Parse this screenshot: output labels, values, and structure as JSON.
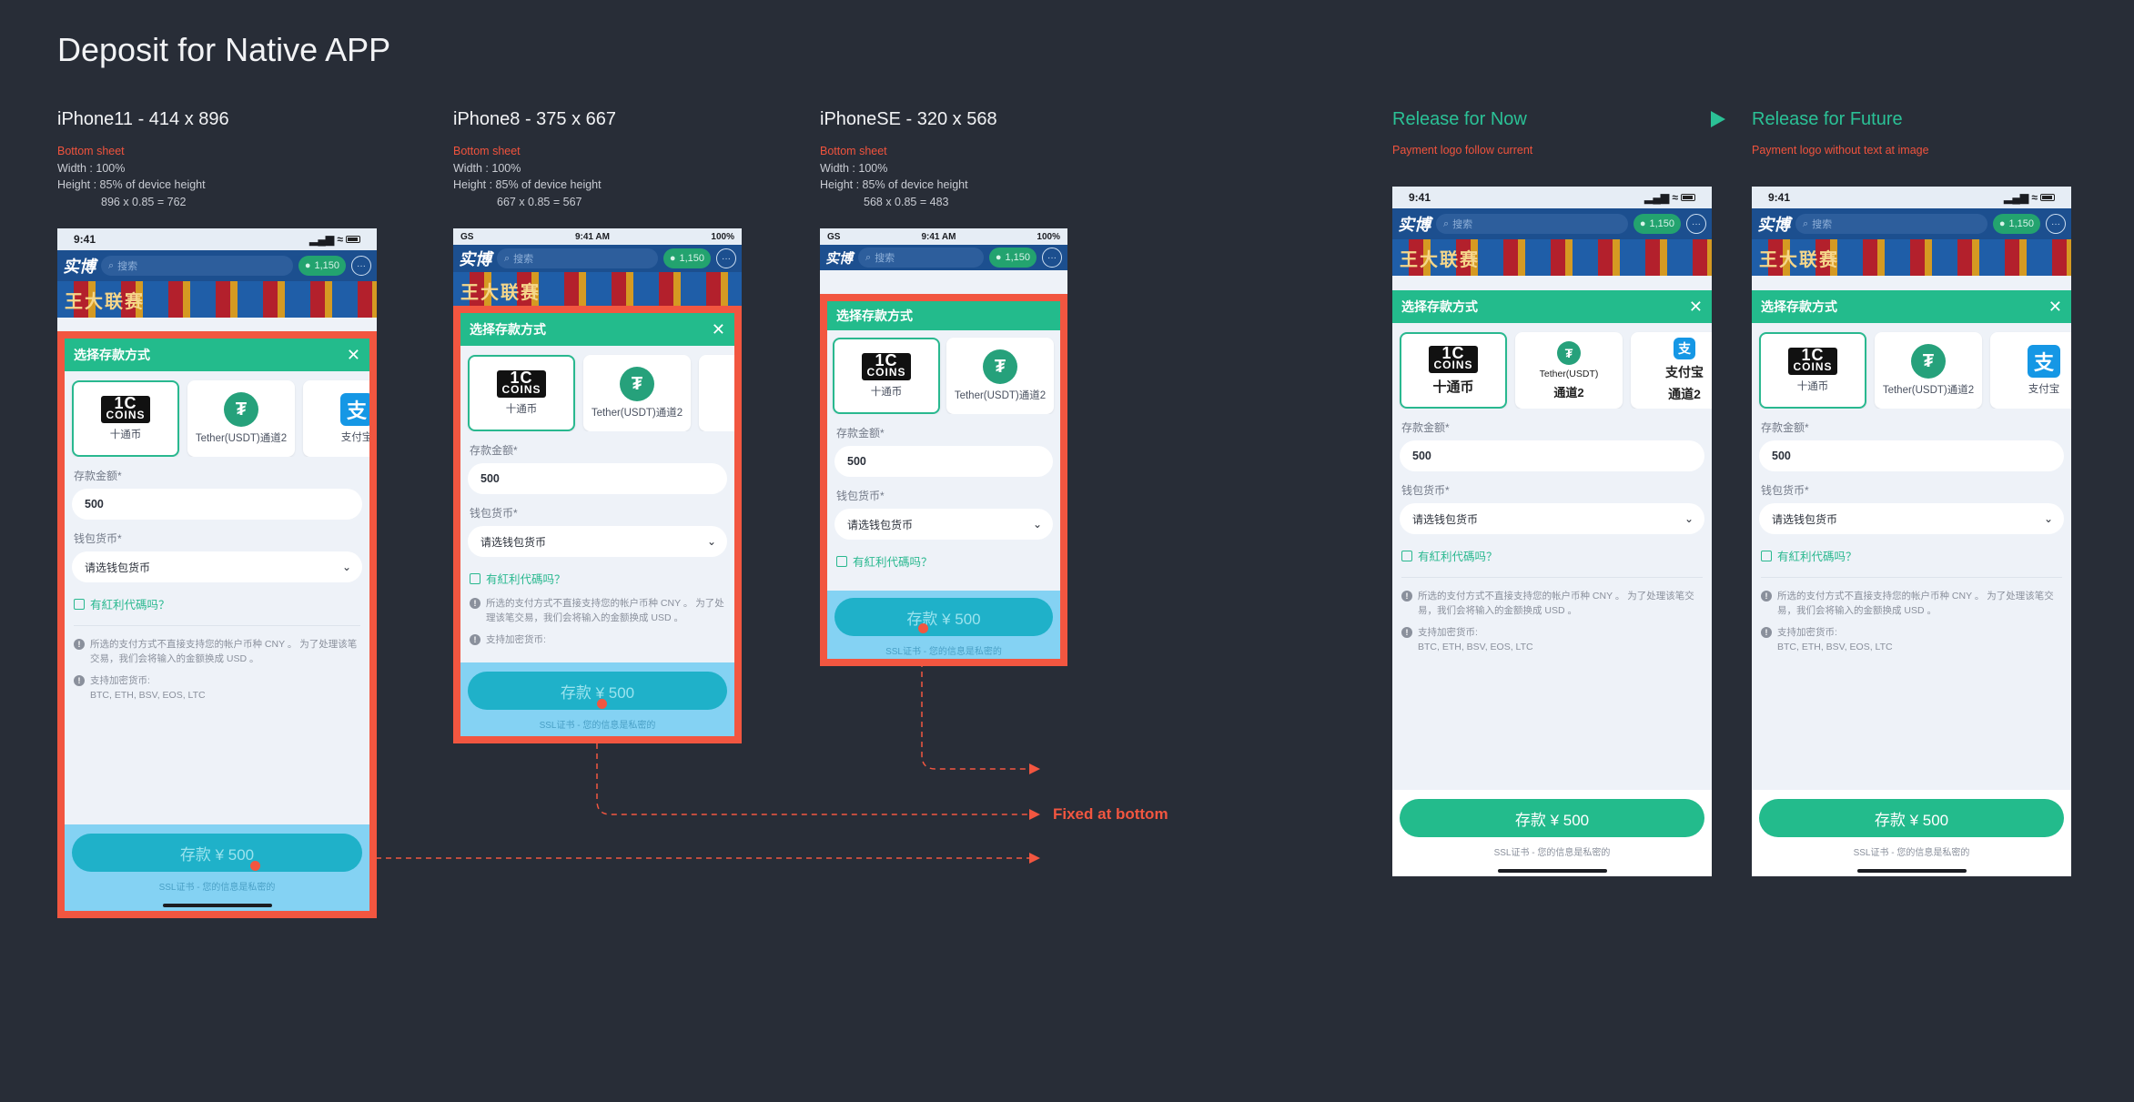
{
  "page": {
    "title": "Deposit for Native APP"
  },
  "columns": [
    {
      "title": "iPhone11 - 414 x 896",
      "spec_label": "Bottom sheet",
      "spec_lines": [
        "Width : 100%",
        "Height : 85% of device height",
        "896 x 0.85 = 762"
      ]
    },
    {
      "title": "iPhone8 - 375 x 667",
      "spec_label": "Bottom sheet",
      "spec_lines": [
        "Width : 100%",
        "Height : 85% of device height",
        "667 x 0.85 = 567"
      ]
    },
    {
      "title": "iPhoneSE - 320 x 568",
      "spec_label": "Bottom sheet",
      "spec_lines": [
        "Width : 100%",
        "Height : 85% of device height",
        "568 x 0.85 = 483"
      ]
    },
    {
      "title": "Release for Now",
      "spec_label": "Payment logo follow current"
    },
    {
      "title": "Release for Future",
      "spec_label": "Payment logo without text at image"
    }
  ],
  "annotation": {
    "fixed_at_bottom": "Fixed at bottom"
  },
  "phone": {
    "time_a": "9:41",
    "time_b": "9:41 AM",
    "carrier": "GS",
    "battery": "100%",
    "logo": "实博",
    "search_placeholder": "搜索",
    "balance": "1,150",
    "banner": "王大联赛"
  },
  "sheet": {
    "title": "选择存款方式",
    "close": "✕",
    "methods": [
      {
        "logo_top": "1C",
        "logo_bottom": "COINS",
        "label": "十通币"
      },
      {
        "logo": "₮",
        "label": "Tether(USDT)通道2"
      },
      {
        "logo": "支",
        "label": "支付宝"
      }
    ],
    "methods_now": [
      {
        "logo_top": "1C",
        "logo_bottom": "COINS",
        "label": "十通币"
      },
      {
        "logo": "₮",
        "label_top": "Tether(USDT)",
        "label": "通道2"
      },
      {
        "logo": "支",
        "label_top": "支付宝",
        "label": "通道2"
      }
    ],
    "amount_label": "存款金额*",
    "amount_value": "500",
    "currency_label": "钱包货币*",
    "currency_placeholder": "请选钱包货币",
    "promo": "有紅利代碼吗？",
    "note1": "所选的支付方式不直接支持您的帐户币种 CNY 。 为了处理该笔交易，我们会将输入的金额换成 USD 。",
    "note2_title": "支持加密货币:",
    "note2_body": "BTC, ETH, BSV, EOS, LTC",
    "note2_cut": "支持加密货币:",
    "cta": "存款 ¥ 500",
    "ssl": "SSL证书 - 您的信息是私密的"
  },
  "colors": {
    "bg": "#282d37",
    "accent": "#23bb8c",
    "highlight": "#f25640",
    "cta_blue": "#1fb1c9"
  }
}
